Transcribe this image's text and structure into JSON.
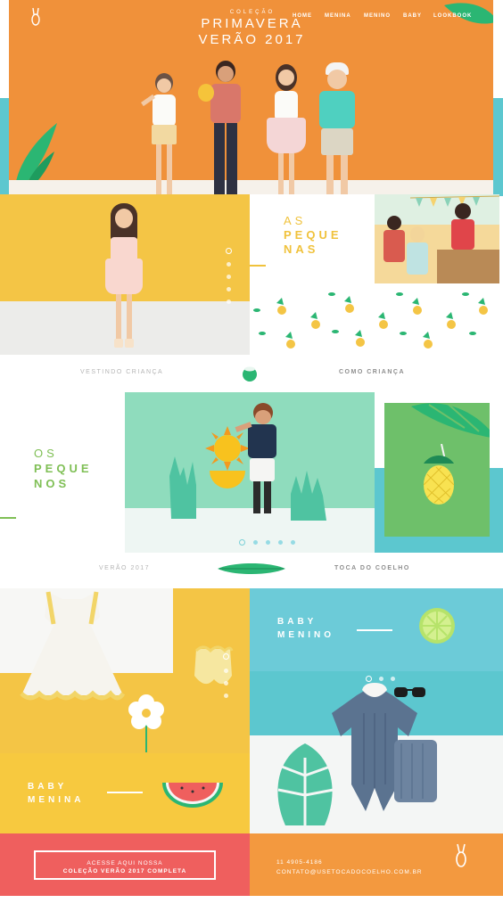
{
  "header": {
    "title_small": "COLEÇÃO",
    "title_line1": "PRIMAVERA",
    "title_line2": "VERÃO 2017",
    "nav": [
      {
        "label": "HOME"
      },
      {
        "label": "MENINA"
      },
      {
        "label": "MENINO"
      },
      {
        "label": "BABY"
      },
      {
        "label": "LOOKBOOK"
      }
    ],
    "logo_icon": "bunny-logo-icon"
  },
  "pequenas": {
    "line1": "AS",
    "line2": "PEQUE",
    "line3": "NAS"
  },
  "row1": {
    "left": "VESTINDO CRIANÇA",
    "right": "COMO CRIANÇA",
    "icon": "coconut-icon"
  },
  "pequenos": {
    "line1": "OS",
    "line2": "PEQUE",
    "line3": "NOS"
  },
  "row2": {
    "left": "VERÃO 2017",
    "right": "TOCA DO COELHO",
    "icon": "leaf-icon"
  },
  "baby_menino": {
    "line1": "BABY",
    "line2": "MENINO"
  },
  "baby_menina": {
    "line1": "BABY",
    "line2": "MENINA"
  },
  "footer": {
    "cta_line1": "ACESSE AQUI NOSSA",
    "cta_line2": "COLEÇÃO VERÃO 2017 COMPLETA",
    "phone": "11 4905-4186",
    "email": "CONTATO@USETOCADOCOELHO.COM.BR"
  },
  "colors": {
    "orange": "#f0913a",
    "yellow": "#f4c545",
    "teal": "#5cc7cf",
    "mint": "#8fdcbd",
    "green": "#6ec06a",
    "red": "#ef5f5e"
  }
}
